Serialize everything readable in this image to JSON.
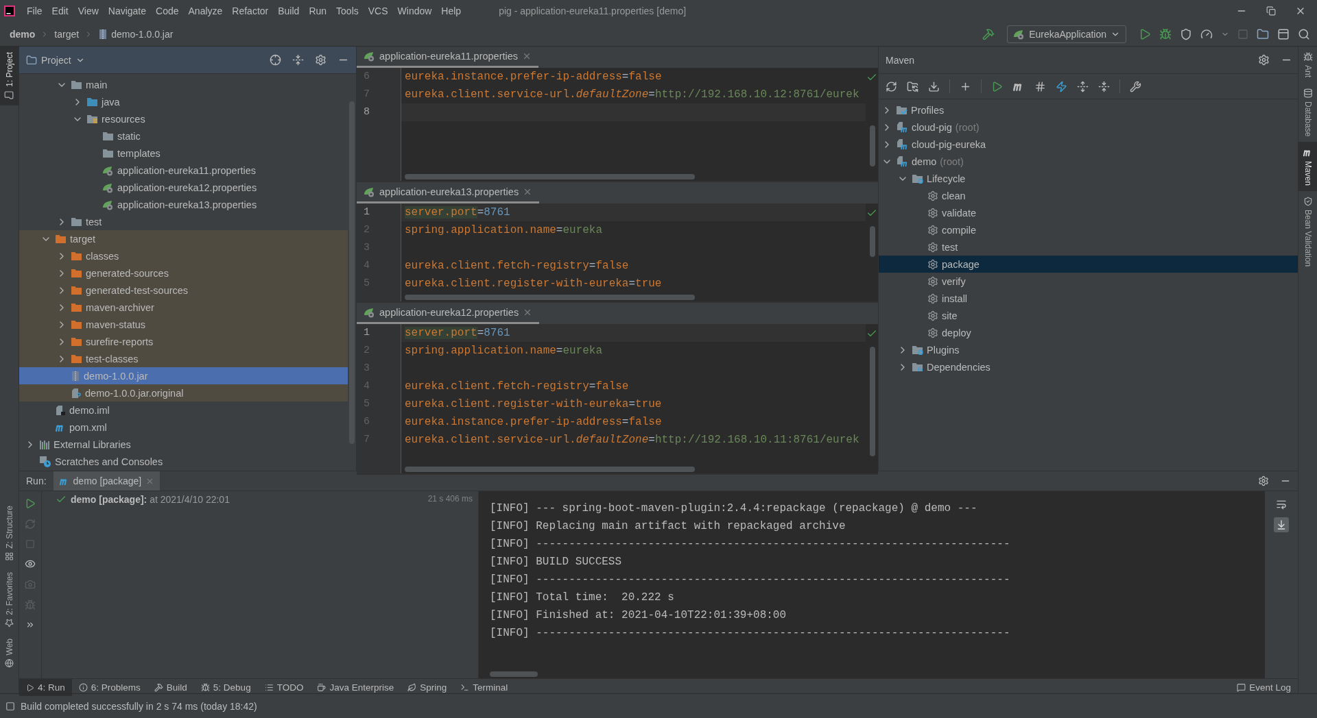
{
  "menu": [
    "File",
    "Edit",
    "View",
    "Navigate",
    "Code",
    "Analyze",
    "Refactor",
    "Build",
    "Run",
    "Tools",
    "VCS",
    "Window",
    "Help"
  ],
  "window_title": "pig - application-eureka11.properties [demo]",
  "breadcrumbs": [
    {
      "label": "demo",
      "kind": "project"
    },
    {
      "label": "target",
      "kind": "folder"
    },
    {
      "label": "demo-1.0.0.jar",
      "kind": "jar"
    }
  ],
  "run_config": "EurekaApplication",
  "left_stripe": {
    "top": [
      {
        "label": "1: Project",
        "kind": "project",
        "selected": true
      }
    ],
    "bottom": [
      {
        "label": "Z: Structure",
        "kind": "structure",
        "selected": false
      },
      {
        "label": "2: Favorites",
        "kind": "favorites",
        "selected": false
      },
      {
        "label": "Web",
        "kind": "web",
        "selected": false
      }
    ]
  },
  "right_stripe": [
    {
      "label": "Ant",
      "kind": "ant",
      "selected": false
    },
    {
      "label": "Database",
      "kind": "database",
      "selected": false
    },
    {
      "label": "Maven",
      "kind": "maven",
      "selected": true
    },
    {
      "label": "Bean Validation",
      "kind": "bean",
      "selected": false
    }
  ],
  "project": {
    "title": "Project",
    "tree": [
      {
        "children": [
          {
            "children": [
              {
                "label": "main",
                "kind": "folder",
                "expanded": true,
                "selected": false,
                "excluded": false,
                "children": [
                  {
                    "label": "java",
                    "kind": "source_folder",
                    "expanded": false,
                    "selected": false,
                    "excluded": false
                  },
                  {
                    "label": "resources",
                    "kind": "resource_folder",
                    "expanded": true,
                    "selected": false,
                    "excluded": false,
                    "children": [
                      {
                        "label": "static",
                        "kind": "folder",
                        "selected": false,
                        "excluded": false
                      },
                      {
                        "label": "templates",
                        "kind": "folder",
                        "selected": false,
                        "excluded": false
                      },
                      {
                        "label": "application-eureka11.properties",
                        "kind": "spring",
                        "selected": false,
                        "excluded": false
                      },
                      {
                        "label": "application-eureka12.properties",
                        "kind": "spring",
                        "selected": false,
                        "excluded": false
                      },
                      {
                        "label": "application-eureka13.properties",
                        "kind": "spring",
                        "selected": false,
                        "excluded": false
                      }
                    ]
                  }
                ]
              },
              {
                "label": "test",
                "kind": "folder",
                "expanded": false,
                "selected": false,
                "excluded": false
              }
            ]
          },
          {
            "label": "target",
            "kind": "excluded_folder",
            "expanded": true,
            "selected": false,
            "excluded": true,
            "children": [
              {
                "label": "classes",
                "kind": "excluded_folder",
                "expanded": false,
                "selected": false,
                "excluded": true
              },
              {
                "label": "generated-sources",
                "kind": "excluded_folder",
                "expanded": false,
                "selected": false,
                "excluded": true
              },
              {
                "label": "generated-test-sources",
                "kind": "excluded_folder",
                "expanded": false,
                "selected": false,
                "excluded": true
              },
              {
                "label": "maven-archiver",
                "kind": "excluded_folder",
                "expanded": false,
                "selected": false,
                "excluded": true
              },
              {
                "label": "maven-status",
                "kind": "excluded_folder",
                "expanded": false,
                "selected": false,
                "excluded": true
              },
              {
                "label": "surefire-reports",
                "kind": "excluded_folder",
                "expanded": false,
                "selected": false,
                "excluded": true
              },
              {
                "label": "test-classes",
                "kind": "excluded_folder",
                "expanded": false,
                "selected": false,
                "excluded": true
              },
              {
                "label": "demo-1.0.0.jar",
                "kind": "jar",
                "selected": true,
                "excluded": true
              },
              {
                "label": "demo-1.0.0.jar.original",
                "kind": "unknown_file",
                "selected": false,
                "excluded": true
              }
            ]
          },
          {
            "label": "demo.iml",
            "kind": "module_file",
            "selected": false,
            "excluded": false
          },
          {
            "label": "pom.xml",
            "kind": "maven",
            "selected": false,
            "excluded": false
          }
        ]
      },
      {
        "label": "External Libraries",
        "kind": "libraries",
        "expanded": false,
        "selected": false,
        "excluded": false
      },
      {
        "label": "Scratches and Consoles",
        "kind": "scratches",
        "selected": false,
        "excluded": false
      }
    ]
  },
  "editors": [
    {
      "tab": "application-eureka11.properties",
      "lines": [
        {
          "number": "6",
          "current": false,
          "tokens": [
            {
              "text": "eureka.instance.prefer-ip-address",
              "kind": "key"
            },
            {
              "text": "=",
              "kind": "eq"
            },
            {
              "text": "false",
              "kind": "key"
            }
          ]
        },
        {
          "number": "7",
          "current": false,
          "tokens": [
            {
              "text": "eureka.client.service-url.",
              "kind": "key"
            },
            {
              "text": "defaultZone",
              "kind": "italic_key"
            },
            {
              "text": "=",
              "kind": "eq"
            },
            {
              "text": "http://192.168.10.12:8761/eurek",
              "kind": "value"
            }
          ]
        },
        {
          "number": "8",
          "current": true
        }
      ]
    },
    {
      "tab": "application-eureka13.properties",
      "lines": [
        {
          "number": "1",
          "current": true,
          "tokens": [
            {
              "text": "server.port",
              "kind": "marked_key"
            },
            {
              "text": "=",
              "kind": "eq"
            },
            {
              "text": "8761",
              "kind": "number"
            }
          ]
        },
        {
          "number": "2",
          "current": false,
          "tokens": [
            {
              "text": "spring.application.name",
              "kind": "key"
            },
            {
              "text": "=",
              "kind": "eq"
            },
            {
              "text": "eureka",
              "kind": "value"
            }
          ]
        },
        {
          "number": "3",
          "current": false
        },
        {
          "number": "4",
          "current": false,
          "tokens": [
            {
              "text": "eureka.client.fetch-registry",
              "kind": "key"
            },
            {
              "text": "=",
              "kind": "eq"
            },
            {
              "text": "false",
              "kind": "key"
            }
          ]
        },
        {
          "number": "5",
          "current": false,
          "tokens": [
            {
              "text": "eureka.client.register-with-eureka",
              "kind": "key"
            },
            {
              "text": "=",
              "kind": "eq"
            },
            {
              "text": "true",
              "kind": "key"
            }
          ]
        }
      ]
    },
    {
      "tab": "application-eureka12.properties",
      "lines": [
        {
          "number": "1",
          "current": true,
          "tokens": [
            {
              "text": "server.port",
              "kind": "marked_key"
            },
            {
              "text": "=",
              "kind": "eq"
            },
            {
              "text": "8761",
              "kind": "number"
            }
          ]
        },
        {
          "number": "2",
          "current": false,
          "tokens": [
            {
              "text": "spring.application.name",
              "kind": "key"
            },
            {
              "text": "=",
              "kind": "eq"
            },
            {
              "text": "eureka",
              "kind": "value"
            }
          ]
        },
        {
          "number": "3",
          "current": false
        },
        {
          "number": "4",
          "current": false,
          "tokens": [
            {
              "text": "eureka.client.fetch-registry",
              "kind": "key"
            },
            {
              "text": "=",
              "kind": "eq"
            },
            {
              "text": "false",
              "kind": "key"
            }
          ]
        },
        {
          "number": "5",
          "current": false,
          "tokens": [
            {
              "text": "eureka.client.register-with-eureka",
              "kind": "key"
            },
            {
              "text": "=",
              "kind": "eq"
            },
            {
              "text": "true",
              "kind": "key"
            }
          ]
        },
        {
          "number": "6",
          "current": false,
          "tokens": [
            {
              "text": "eureka.instance.prefer-ip-address",
              "kind": "key"
            },
            {
              "text": "=",
              "kind": "eq"
            },
            {
              "text": "false",
              "kind": "key"
            }
          ]
        },
        {
          "number": "7",
          "current": false,
          "tokens": [
            {
              "text": "eureka.client.service-url.",
              "kind": "key"
            },
            {
              "text": "defaultZone",
              "kind": "italic_key"
            },
            {
              "text": "=",
              "kind": "eq"
            },
            {
              "text": "http://192.168.10.11:8761/eurek",
              "kind": "value"
            }
          ]
        }
      ]
    }
  ],
  "maven": {
    "title": "Maven",
    "tree": [
      {
        "label": "Profiles",
        "kind": "profiles",
        "expanded": false,
        "selected": false
      },
      {
        "label": "cloud-pig",
        "note": "(root)",
        "kind": "maven_project",
        "expanded": false,
        "selected": false
      },
      {
        "label": "cloud-pig-eureka",
        "kind": "maven_project",
        "expanded": false,
        "selected": false
      },
      {
        "label": "demo",
        "note": "(root)",
        "kind": "maven_project",
        "expanded": true,
        "selected": false,
        "children": [
          {
            "label": "Lifecycle",
            "kind": "lifecycle",
            "expanded": true,
            "selected": false,
            "children": [
              {
                "label": "clean",
                "kind": "goal",
                "selected": false
              },
              {
                "label": "validate",
                "kind": "goal",
                "selected": false
              },
              {
                "label": "compile",
                "kind": "goal",
                "selected": false
              },
              {
                "label": "test",
                "kind": "goal",
                "selected": false
              },
              {
                "label": "package",
                "kind": "goal",
                "selected": true
              },
              {
                "label": "verify",
                "kind": "goal",
                "selected": false
              },
              {
                "label": "install",
                "kind": "goal",
                "selected": false
              },
              {
                "label": "site",
                "kind": "goal",
                "selected": false
              },
              {
                "label": "deploy",
                "kind": "goal",
                "selected": false
              }
            ]
          },
          {
            "label": "Plugins",
            "kind": "plugins",
            "expanded": false,
            "selected": false
          },
          {
            "label": "Dependencies",
            "kind": "dependencies",
            "expanded": false,
            "selected": false
          }
        ]
      }
    ]
  },
  "run": {
    "label": "Run:",
    "tab": "demo [package]",
    "item": {
      "text": "**demo [package]:** at 2021/4/10 22:01",
      "duration": "21 s 406 ms",
      "passed": true
    },
    "console": [
      "[INFO] --- spring-boot-maven-plugin:2.4.4:repackage (repackage) @ demo ---",
      "[INFO] Replacing main artifact with repackaged archive",
      "[INFO] ------------------------------------------------------------------------",
      "[INFO] BUILD SUCCESS",
      "[INFO] ------------------------------------------------------------------------",
      "[INFO] Total time:  20.222 s",
      "[INFO] Finished at: 2021-04-10T22:01:39+08:00",
      "[INFO] ------------------------------------------------------------------------"
    ]
  },
  "tool_windows": [
    {
      "label": "4: Run",
      "kind": "run",
      "selected": true
    },
    {
      "label": "6: Problems",
      "kind": "problems",
      "selected": false
    },
    {
      "label": "Build",
      "kind": "build",
      "selected": false
    },
    {
      "label": "5: Debug",
      "kind": "debug",
      "selected": false
    },
    {
      "label": "TODO",
      "kind": "todo",
      "selected": false
    },
    {
      "label": "Java Enterprise",
      "kind": "java_enterprise",
      "selected": false
    },
    {
      "label": "Spring",
      "kind": "spring",
      "selected": false
    },
    {
      "label": "Terminal",
      "kind": "terminal",
      "selected": false
    }
  ],
  "event_log": "Event Log",
  "status": "Build completed successfully in 2 s 74 ms (today 18:42)"
}
